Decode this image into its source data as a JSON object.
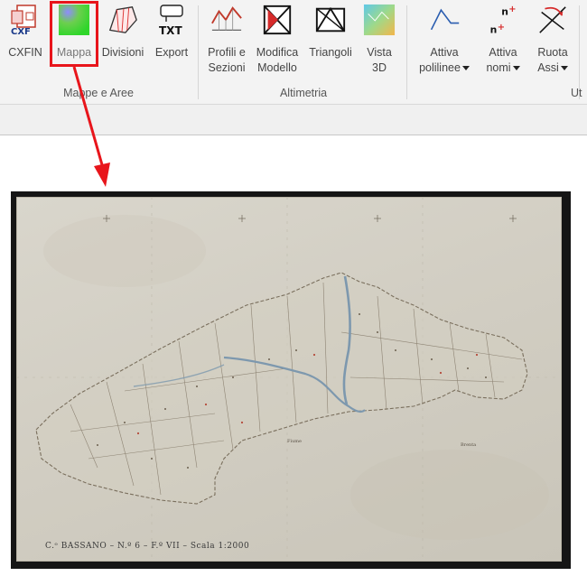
{
  "ribbon": {
    "buttons": {
      "cxfin": {
        "label": "CXFIN",
        "icon": "cxf-file-icon"
      },
      "mappa": {
        "label": "Mappa",
        "icon": "map-image-icon"
      },
      "divisioni": {
        "label": "Divisioni",
        "icon": "divisions-polygon-icon"
      },
      "export": {
        "label": "Export",
        "icon": "txt-export-icon"
      },
      "profili": {
        "label": "Profili e\nSezioni",
        "icon": "profile-sections-icon"
      },
      "modifica": {
        "label": "Modifica\nModello",
        "icon": "edit-model-icon"
      },
      "triangoli": {
        "label": "Triangoli",
        "icon": "triangles-icon"
      },
      "vista3d": {
        "label": "Vista\n3D",
        "icon": "3d-view-icon"
      },
      "polilinee": {
        "label": "Attiva\npolilinee",
        "icon": "polyline-icon"
      },
      "nomi": {
        "label": "Attiva\nnomi",
        "icon": "names-n-plus-icon"
      },
      "ruota": {
        "label": "Ruota\nAssi",
        "icon": "rotate-axes-icon"
      }
    },
    "groups": {
      "mappe": "Mappe e Aree",
      "altimetria": "Altimetria",
      "utility": "Ut"
    }
  },
  "map": {
    "caption": "C.ᵒ BASSANO – N.º 6 – F.º VII – Scala 1:2000",
    "labels": [
      "Fiume",
      "Brenta"
    ]
  },
  "annotation": {
    "highlight_color": "#e8151b"
  }
}
